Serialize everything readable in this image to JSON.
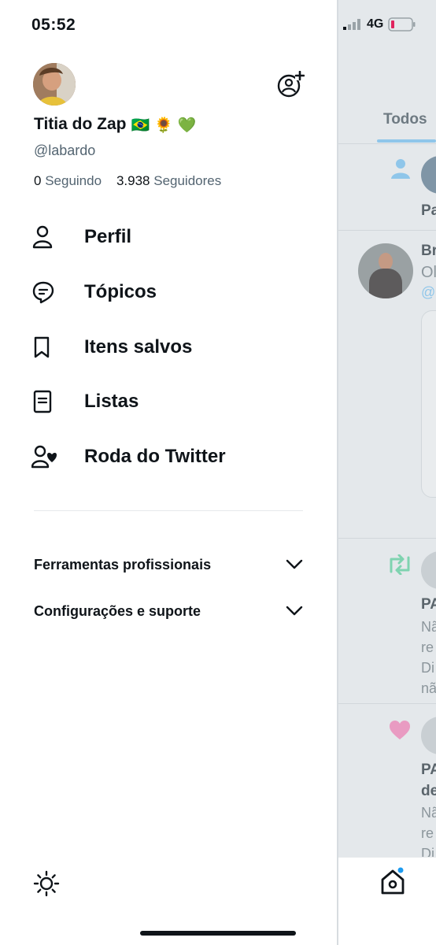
{
  "status_bar": {
    "time": "05:52",
    "network": "4G"
  },
  "profile": {
    "display_name": "Titia do Zap",
    "name_emojis": [
      "🇧🇷",
      "🌻",
      "💚"
    ],
    "handle": "@labardo",
    "following_count": "0",
    "following_label": "Seguindo",
    "followers_count": "3.938",
    "followers_label": "Seguidores"
  },
  "menu": [
    {
      "label": "Perfil",
      "icon": "person-icon"
    },
    {
      "label": "Tópicos",
      "icon": "topics-icon"
    },
    {
      "label": "Itens salvos",
      "icon": "bookmark-icon"
    },
    {
      "label": "Listas",
      "icon": "list-icon"
    },
    {
      "label": "Roda do Twitter",
      "icon": "twitter-circle-icon"
    }
  ],
  "sections": [
    {
      "label": "Ferramentas profissionais",
      "icon": "chevron-down-icon"
    },
    {
      "label": "Configurações e suporte",
      "icon": "chevron-down-icon"
    }
  ],
  "background": {
    "tab": "Todos",
    "snippets": [
      "Pa",
      "Br",
      "Ol",
      "@",
      "PA",
      "Nã",
      "re",
      "Di",
      "nã",
      "PA",
      "de",
      "Nã",
      "re",
      "Di"
    ]
  },
  "colors": {
    "accent": "#1d9bf0",
    "retweet": "#00ba7c",
    "like": "#f91880",
    "text": "#0f1419",
    "muted": "#536471"
  }
}
